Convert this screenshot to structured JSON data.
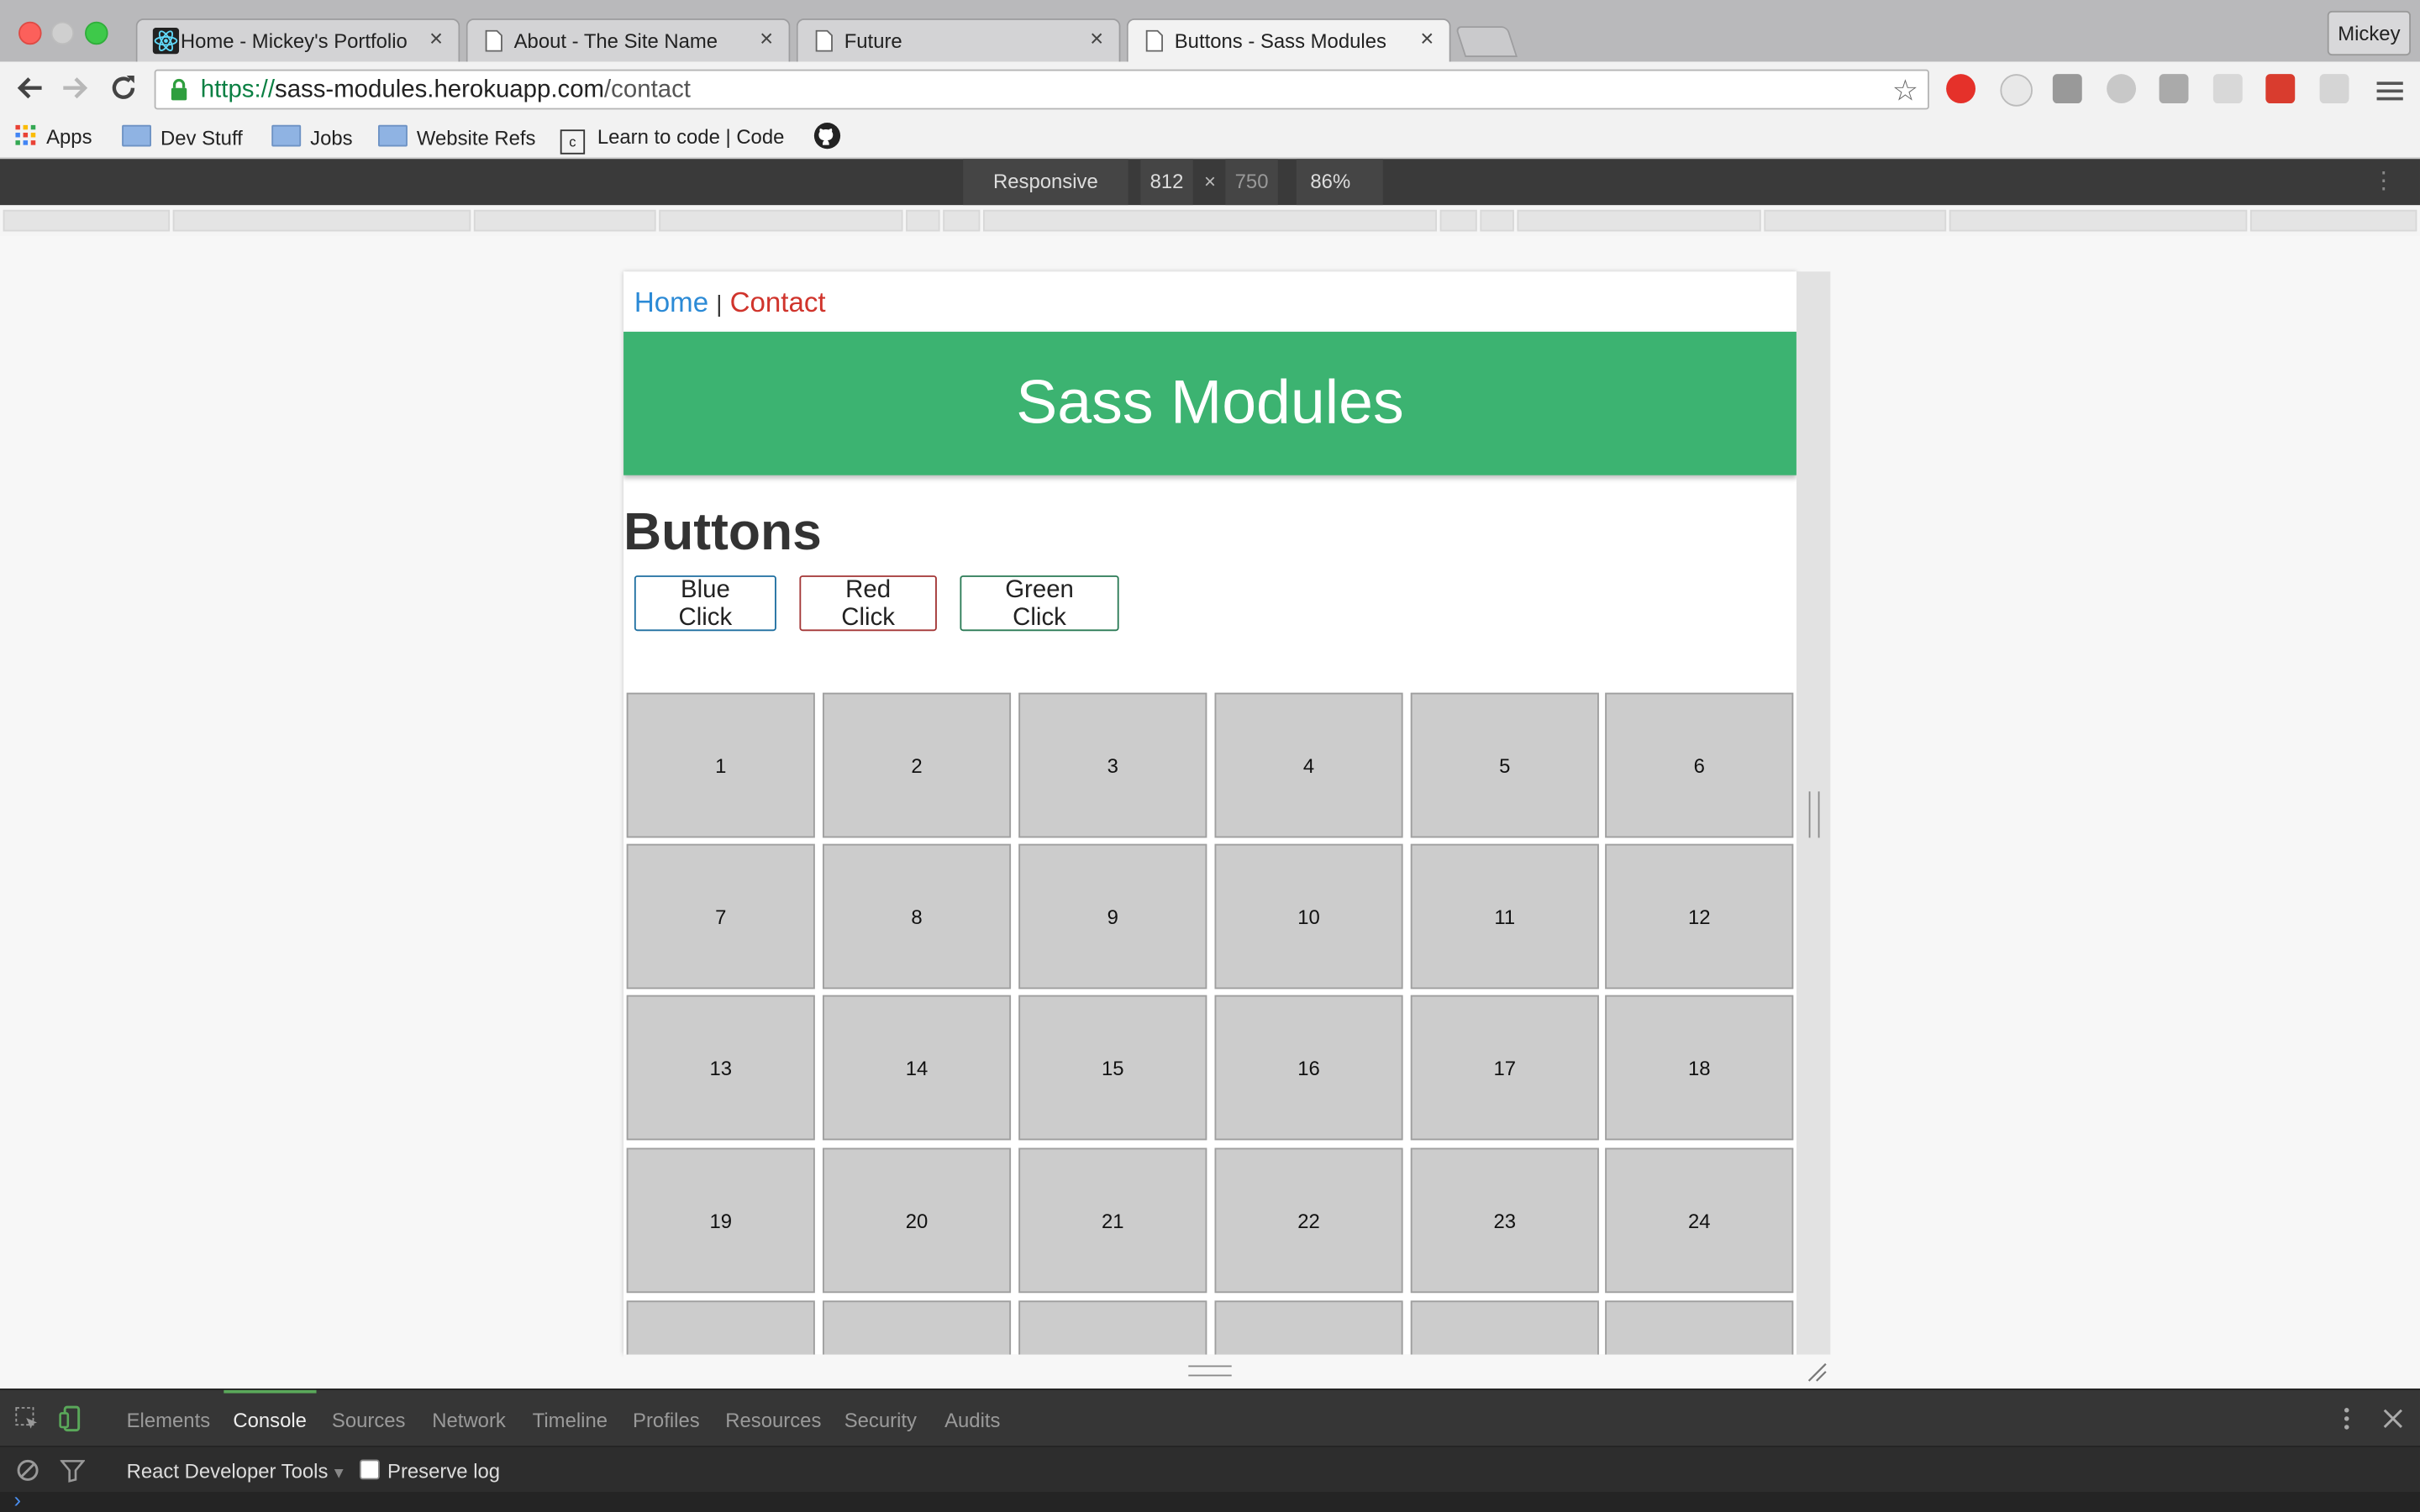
{
  "browser": {
    "tabs": [
      {
        "title": "Home - Mickey's Portfolio",
        "active": false
      },
      {
        "title": "About - The Site Name",
        "active": false
      },
      {
        "title": "Future",
        "active": false
      },
      {
        "title": "Buttons - Sass Modules",
        "active": true
      }
    ],
    "close_glyph": "×",
    "profile_name": "Mickey",
    "url": {
      "scheme": "https://",
      "host": "sass-modules.herokuapp.com",
      "path": "/contact"
    },
    "bookmarks": {
      "apps": "Apps",
      "dev_stuff": "Dev Stuff",
      "jobs": "Jobs",
      "website_refs": "Website Refs",
      "learn": "Learn to code | Code"
    },
    "colors": {
      "accent_green": "#3cb371",
      "link_blue": "#2b8ad6",
      "link_red": "#d0342c"
    }
  },
  "device_toolbar": {
    "mode": "Responsive",
    "width": "812",
    "times": "×",
    "height": "750",
    "zoom": "86%"
  },
  "site": {
    "nav_home": "Home",
    "nav_separator": "|",
    "nav_contact": "Contact",
    "hero_title": "Sass Modules",
    "section_title": "Buttons",
    "buttons": {
      "blue": "Blue Click",
      "red": "Red Click",
      "green": "Green Click"
    },
    "grid_cells": [
      "1",
      "2",
      "3",
      "4",
      "5",
      "6",
      "7",
      "8",
      "9",
      "10",
      "11",
      "12",
      "13",
      "14",
      "15",
      "16",
      "17",
      "18",
      "19",
      "20",
      "21",
      "22",
      "23",
      "24",
      "",
      "",
      "",
      "",
      "",
      ""
    ]
  },
  "devtools": {
    "tabs": [
      "Elements",
      "Console",
      "Sources",
      "Network",
      "Timeline",
      "Profiles",
      "Resources",
      "Security",
      "Audits"
    ],
    "active_tab": "Console",
    "context": "React Developer Tools",
    "preserve_log": "Preserve log",
    "prompt": "›"
  }
}
